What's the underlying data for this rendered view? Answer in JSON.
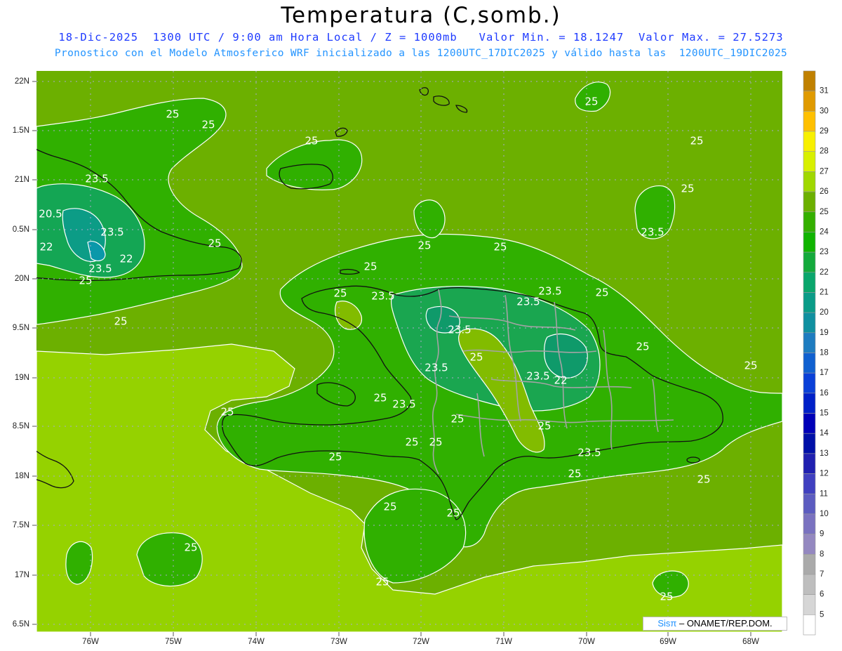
{
  "title": "Temperatura (C,somb.)",
  "subtitle_1": "18-Dic-2025  1300 UTC / 9:00 am Hora Local / Z = 1000mb   Valor Min. = 18.1247  Valor Max. = 27.5273",
  "subtitle_2": "Pronostico con el Modelo Atmosferico WRF inicializado a las 1200UTC_17DIC2025 y válido hasta las  1200UTC_19DIC2025",
  "map": {
    "lat_labels": [
      "22N",
      "1.5N",
      "21N",
      "0.5N",
      "20N",
      "9.5N",
      "19N",
      "8.5N",
      "18N",
      "7.5N",
      "17N",
      "6.5N"
    ],
    "lon_labels": [
      "76W",
      "75W",
      "74W",
      "73W",
      "72W",
      "71W",
      "70W",
      "69W",
      "68W"
    ],
    "contour_labels": [
      "25",
      "25",
      "25",
      "25",
      "25",
      "23.5",
      "25",
      "20.5",
      "23.5",
      "23.5",
      "22",
      "25",
      "25",
      "25",
      "22",
      "25",
      "23.5",
      "25",
      "25",
      "25",
      "23.5",
      "23.5",
      "23.5",
      "25",
      "23.5",
      "25",
      "25",
      "25",
      "23.5",
      "23.5",
      "22",
      "25",
      "23.5",
      "25",
      "25",
      "25",
      "25",
      "25",
      "23.5",
      "25",
      "25",
      "25",
      "25",
      "25",
      "25",
      "25",
      "25"
    ]
  },
  "legend": {
    "labels": [
      "31",
      "30",
      "29",
      "28",
      "27",
      "26",
      "25",
      "24",
      "23",
      "22",
      "21",
      "20",
      "19",
      "18",
      "17",
      "16",
      "15",
      "14",
      "13",
      "12",
      "11",
      "10",
      "9",
      "8",
      "7",
      "6",
      "5"
    ],
    "colors": [
      "#c08000",
      "#e09a00",
      "#ffc000",
      "#f8f000",
      "#d8f000",
      "#a0d800",
      "#6cb000",
      "#34b000",
      "#10b400",
      "#14aa3c",
      "#0aa66c",
      "#0a9c88",
      "#1090a0",
      "#1e7cc0",
      "#1060d0",
      "#0a40d8",
      "#0020c8",
      "#0000b8",
      "#0010a8",
      "#2020b0",
      "#4040c0",
      "#5c5cc0",
      "#7a72c0",
      "#9488c0",
      "#aaaaaa",
      "#bebebe",
      "#d6d6d6",
      "#ffffff"
    ]
  },
  "credit": {
    "brand": "Sisπ",
    "text": " – ONAMET/REP.DOM."
  }
}
